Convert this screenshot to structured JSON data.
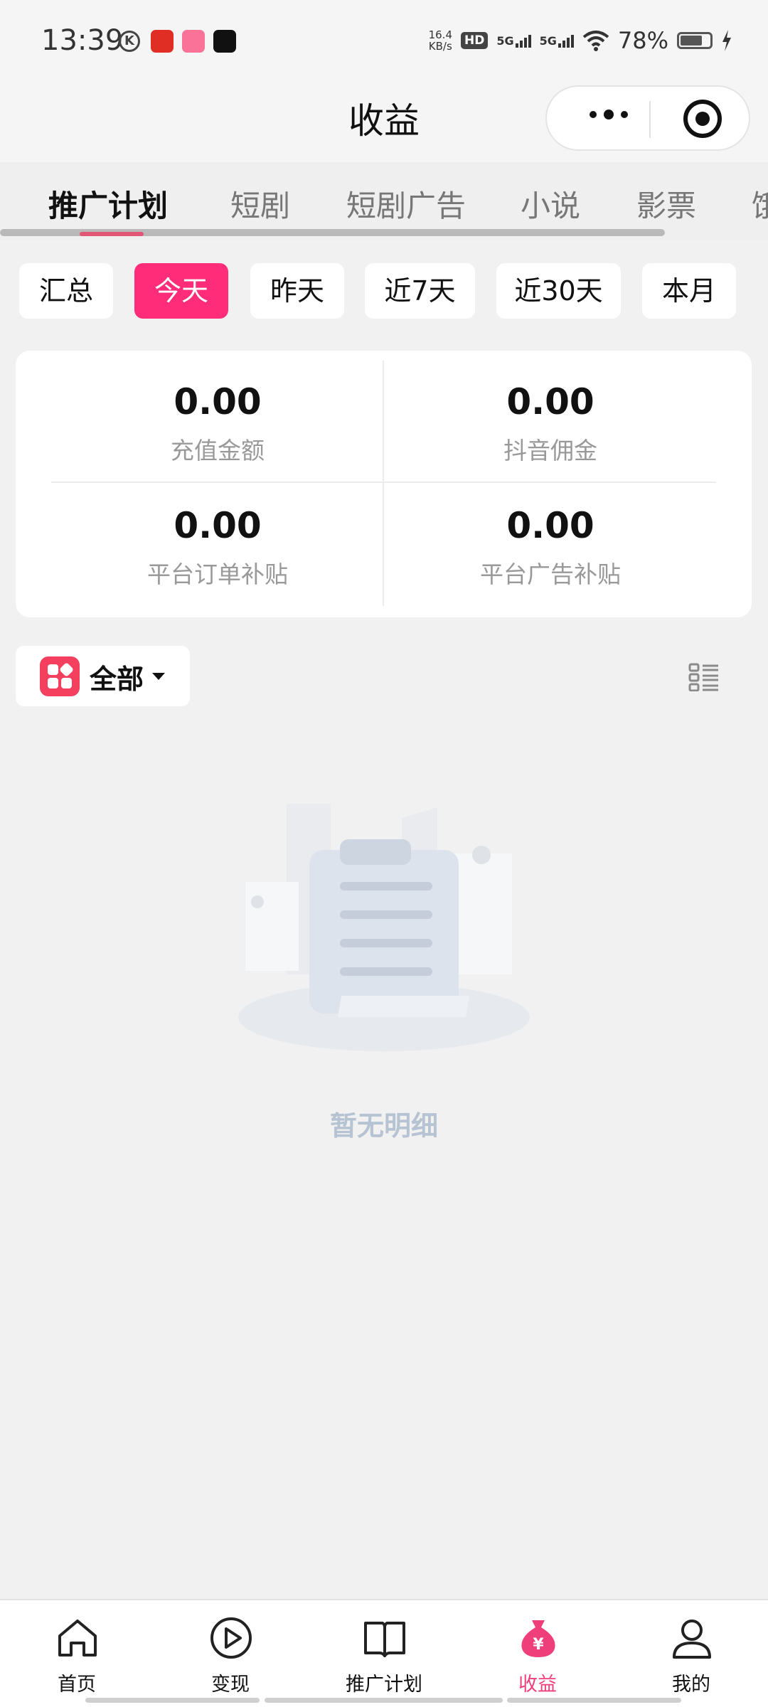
{
  "status_bar": {
    "time": "13:39",
    "net_speed_value": "16.4",
    "net_speed_unit": "KB/s",
    "hd_label": "HD",
    "sim1_label": "5G",
    "sim2_label": "5G",
    "battery": "78%",
    "app_icons": [
      "pinduoduo",
      "bilibili",
      "douyin"
    ]
  },
  "header": {
    "title": "收益"
  },
  "category_tabs": [
    {
      "label": "推广计划",
      "active": true
    },
    {
      "label": "短剧",
      "active": false
    },
    {
      "label": "短剧广告",
      "active": false
    },
    {
      "label": "小说",
      "active": false
    },
    {
      "label": "影票",
      "active": false
    },
    {
      "label": "饿",
      "active": false
    }
  ],
  "period_filters": [
    {
      "label": "汇总",
      "active": false
    },
    {
      "label": "今天",
      "active": true
    },
    {
      "label": "昨天",
      "active": false
    },
    {
      "label": "近7天",
      "active": false
    },
    {
      "label": "近30天",
      "active": false
    },
    {
      "label": "本月",
      "active": false
    }
  ],
  "stats": [
    {
      "value": "0.00",
      "label": "充值金额"
    },
    {
      "value": "0.00",
      "label": "抖音佣金"
    },
    {
      "value": "0.00",
      "label": "平台订单补贴"
    },
    {
      "value": "0.00",
      "label": "平台广告补贴"
    }
  ],
  "filter": {
    "label": "全部",
    "icon": "grid-icon"
  },
  "empty_state": {
    "text": "暂无明细"
  },
  "bottom_nav": [
    {
      "label": "首页",
      "icon": "home-icon",
      "active": false
    },
    {
      "label": "变现",
      "icon": "play-icon",
      "active": false
    },
    {
      "label": "推广计划",
      "icon": "book-icon",
      "active": false
    },
    {
      "label": "收益",
      "icon": "money-bag-icon",
      "active": true
    },
    {
      "label": "我的",
      "icon": "user-icon",
      "active": false
    }
  ],
  "colors": {
    "accent": "#ff2d79",
    "nav_active": "#ef3f7b",
    "background": "#f1f1f1"
  }
}
